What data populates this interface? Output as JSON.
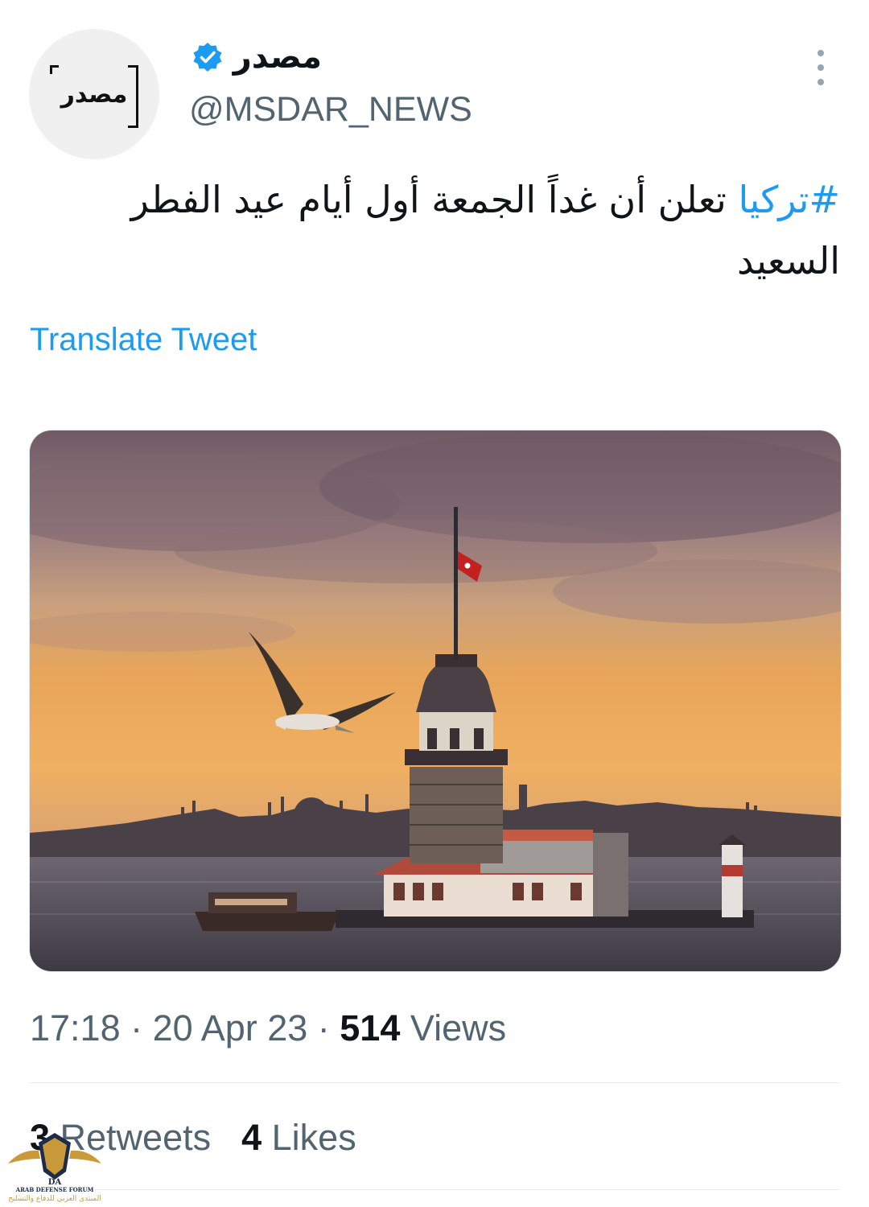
{
  "user": {
    "display_name": "مصدر",
    "handle": "@MSDAR_NEWS",
    "avatar_text": "مصدر"
  },
  "tweet": {
    "hashtag": "#تركيا",
    "text": " تعلن أن غداً الجمعة أول أيام عيد الفطر السعيد",
    "translate_label": "Translate Tweet",
    "image_alt": "Maiden's Tower at sunset with seagull"
  },
  "meta": {
    "time": "17:18",
    "separator": " · ",
    "date": "20 Apr 23",
    "views_count": "514",
    "views_label": " Views"
  },
  "stats": {
    "retweets_count": "3",
    "retweets_label": " Retweets",
    "likes_count": "4",
    "likes_label": " Likes"
  },
  "watermark": {
    "title": "ARAB DEFENSE FORUM",
    "subtitle": "المنتدى العربي للدفاع والتسليح",
    "logo_letters": "DA"
  },
  "colors": {
    "accent": "#1d9bf0",
    "secondary_text": "#536471",
    "primary_text": "#0f1419"
  },
  "icons": {
    "verified": "verified-badge-icon",
    "more": "more-vertical-icon"
  }
}
